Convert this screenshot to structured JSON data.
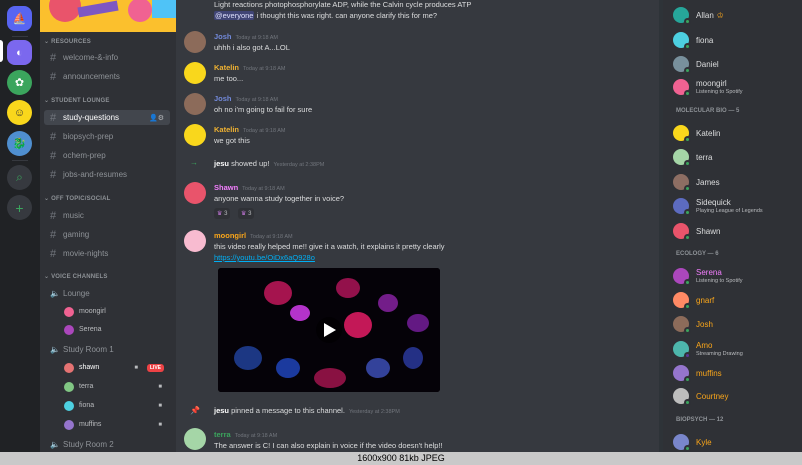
{
  "channels": {
    "categories": [
      "RESOURCES",
      "STUDENT LOUNGE",
      "OFF TOPIC/SOCIAL",
      "VOICE CHANNELS"
    ],
    "resources": [
      "welcome-&-info",
      "announcements"
    ],
    "lounge": [
      "study-questions",
      "biopsych-prep",
      "ochem-prep",
      "jobs-and-resumes"
    ],
    "offtopic": [
      "music",
      "gaming",
      "movie-nights"
    ],
    "voice": [
      "Lounge",
      "Study Room 1",
      "Study Room 2"
    ],
    "lounge_users": [
      "moongirl",
      "Serena"
    ],
    "room1_users": [
      "shawn",
      "terra",
      "fiona",
      "muffins"
    ],
    "live": "LIVE"
  },
  "chat": {
    "top_line1": "Light reactions photophosphorylate ADP, while the Calvin cycle produces ATP",
    "top_mention": "@everyone",
    "top_line2": " i thought this was right. can anyone clarify this for me?",
    "messages": [
      {
        "user": "Josh",
        "time": "Today at 9:18 AM",
        "text": "uhhh i also got A...LOL"
      },
      {
        "user": "Katelin",
        "time": "Today at 9:18 AM",
        "text": "me too..."
      },
      {
        "user": "Josh",
        "time": "Today at 9:18 AM",
        "text": "oh no i'm going to fail for sure"
      },
      {
        "user": "Katelin",
        "time": "Today at 9:18 AM",
        "text": "we got this"
      },
      {
        "user": "Shawn",
        "time": "Today at 9:18 AM",
        "text": "anyone wanna study together in voice?"
      },
      {
        "user": "moongirl",
        "time": "Today at 9:18 AM",
        "text": "this video really helped me!! give it a watch, it explains it pretty clearly"
      },
      {
        "user": "terra",
        "time": "Today at 9:18 AM",
        "text": "The answer is C! I can also explain in voice if the video doesn't help!!"
      }
    ],
    "join_user": "jesu",
    "join_text": " showed up!",
    "join_time": "Yesterday at 2:38PM",
    "pin_user": "jesu",
    "pin_text": " pinned a message to this channel.",
    "pin_time": "Yesterday at 2:38PM",
    "link": "https://youtu.be/OiDx6aQ928o",
    "reactions": [
      "3",
      "3"
    ]
  },
  "members": {
    "top": [
      {
        "name": "Allan",
        "sub": ""
      },
      {
        "name": "fiona",
        "sub": ""
      },
      {
        "name": "Daniel",
        "sub": ""
      },
      {
        "name": "moongirl",
        "sub": "Listening to Spotify"
      }
    ],
    "cat_bio": "MOLECULAR BIO — 5",
    "bio": [
      {
        "name": "Katelin",
        "sub": ""
      },
      {
        "name": "terra",
        "sub": ""
      },
      {
        "name": "James",
        "sub": ""
      },
      {
        "name": "Sidequick",
        "sub": "Playing League of Legends"
      },
      {
        "name": "Shawn",
        "sub": ""
      }
    ],
    "cat_eco": "ECOLOGY — 6",
    "eco": [
      {
        "name": "Serena",
        "sub": "Listening to Spotify"
      },
      {
        "name": "gnarf",
        "sub": ""
      },
      {
        "name": "Josh",
        "sub": ""
      },
      {
        "name": "Amo",
        "sub": "Streaming Drawing"
      },
      {
        "name": "muffins",
        "sub": ""
      },
      {
        "name": "Courtney",
        "sub": ""
      }
    ],
    "cat_psych": "BIOPSYCH — 12",
    "psych": [
      {
        "name": "Kyle",
        "sub": ""
      }
    ]
  },
  "colors": {
    "josh": "#7289da",
    "katelin": "#f0b232",
    "shawn": "#f47fff",
    "moongirl": "#faa61a",
    "terra": "#3ba55d",
    "allan": "#dcddde"
  },
  "footer": "1600x900  81kb  JPEG"
}
